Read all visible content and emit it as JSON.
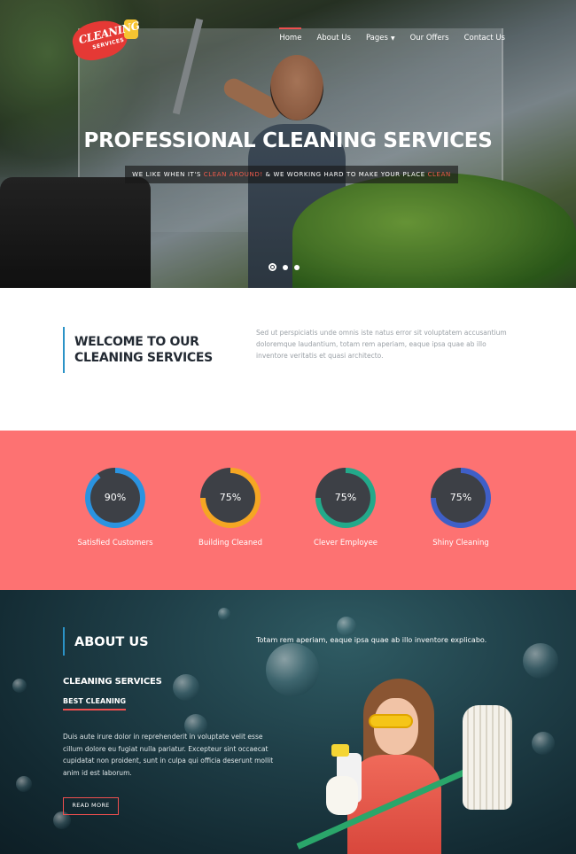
{
  "logo": {
    "line1": "CLEANING",
    "line2": "SERVICES"
  },
  "nav": {
    "items": [
      {
        "label": "Home",
        "active": true
      },
      {
        "label": "About Us"
      },
      {
        "label": "Pages"
      },
      {
        "label": "Our Offers"
      },
      {
        "label": "Contact Us"
      }
    ]
  },
  "hero": {
    "title_light": "PROFESSIONAL ",
    "title_bold": "CLEANING SERVICES",
    "sub_1": "WE LIKE WHEN IT'S ",
    "sub_hl1": "CLEAN AROUND!",
    "sub_2": " & WE WORKING HARD TO MAKE YOUR PLACE ",
    "sub_hl2": "CLEAN",
    "slides": 3,
    "active_slide": 1
  },
  "welcome": {
    "line1": "WELCOME TO OUR",
    "line2": "CLEANING SERVICES",
    "text": "Sed ut perspiciatis unde omnis iste natus error sit voluptatem accusantium doloremque laudantium, totam rem aperiam, eaque ipsa quae ab illo inventore veritatis et quasi architecto."
  },
  "stats": [
    {
      "value": "90%",
      "percent": 90,
      "label": "Satisfied Customers",
      "color": "#2b93e0"
    },
    {
      "value": "75%",
      "percent": 75,
      "label": "Building Cleaned",
      "color": "#f5a623"
    },
    {
      "value": "75%",
      "percent": 75,
      "label": "Clever Employee",
      "color": "#23a98a"
    },
    {
      "value": "75%",
      "percent": 75,
      "label": "Shiny Cleaning",
      "color": "#3f5fc7"
    }
  ],
  "colors": {
    "accent": "#ef4f4f",
    "stats_bg": "#fd7272",
    "bar_blue": "#2b93c7",
    "ring_track": "#3d4046"
  },
  "about": {
    "title": "ABOUT US",
    "lead": "Totam rem aperiam, eaque ipsa quae ab illo inventore explicabo.",
    "heading": "CLEANING SERVICES",
    "subheading": "BEST CLEANING",
    "body": "Duis aute irure dolor in reprehenderit in voluptate velit esse cillum dolore eu fugiat nulla pariatur. Excepteur sint occaecat cupidatat non proident, sunt in culpa qui officia deserunt mollit anim id est laborum.",
    "button": "READ MORE"
  }
}
